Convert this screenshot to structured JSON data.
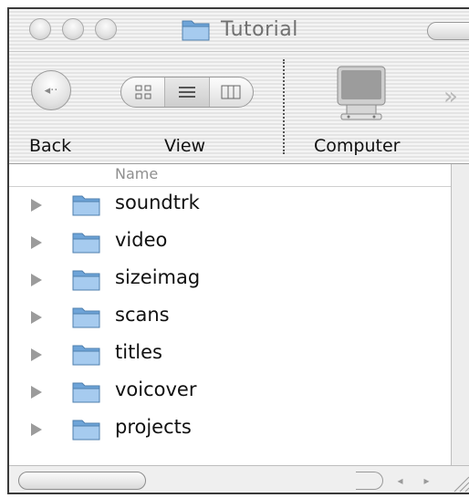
{
  "window": {
    "title": "Tutorial"
  },
  "toolbar": {
    "back_label": "Back",
    "view_label": "View",
    "computer_label": "Computer",
    "overflow_glyph": "»"
  },
  "list": {
    "column_header": "Name",
    "items": [
      {
        "name": "soundtrk"
      },
      {
        "name": "video"
      },
      {
        "name": "sizeimag"
      },
      {
        "name": "scans"
      },
      {
        "name": "titles"
      },
      {
        "name": "voicover"
      },
      {
        "name": "projects"
      }
    ]
  },
  "icons": {
    "folder": "folder-icon",
    "computer": "computer-icon",
    "disclosure": "disclosure-triangle-icon"
  },
  "colors": {
    "folder_blue": "#7fb2e3",
    "chrome_gray": "#e4e4e4"
  }
}
